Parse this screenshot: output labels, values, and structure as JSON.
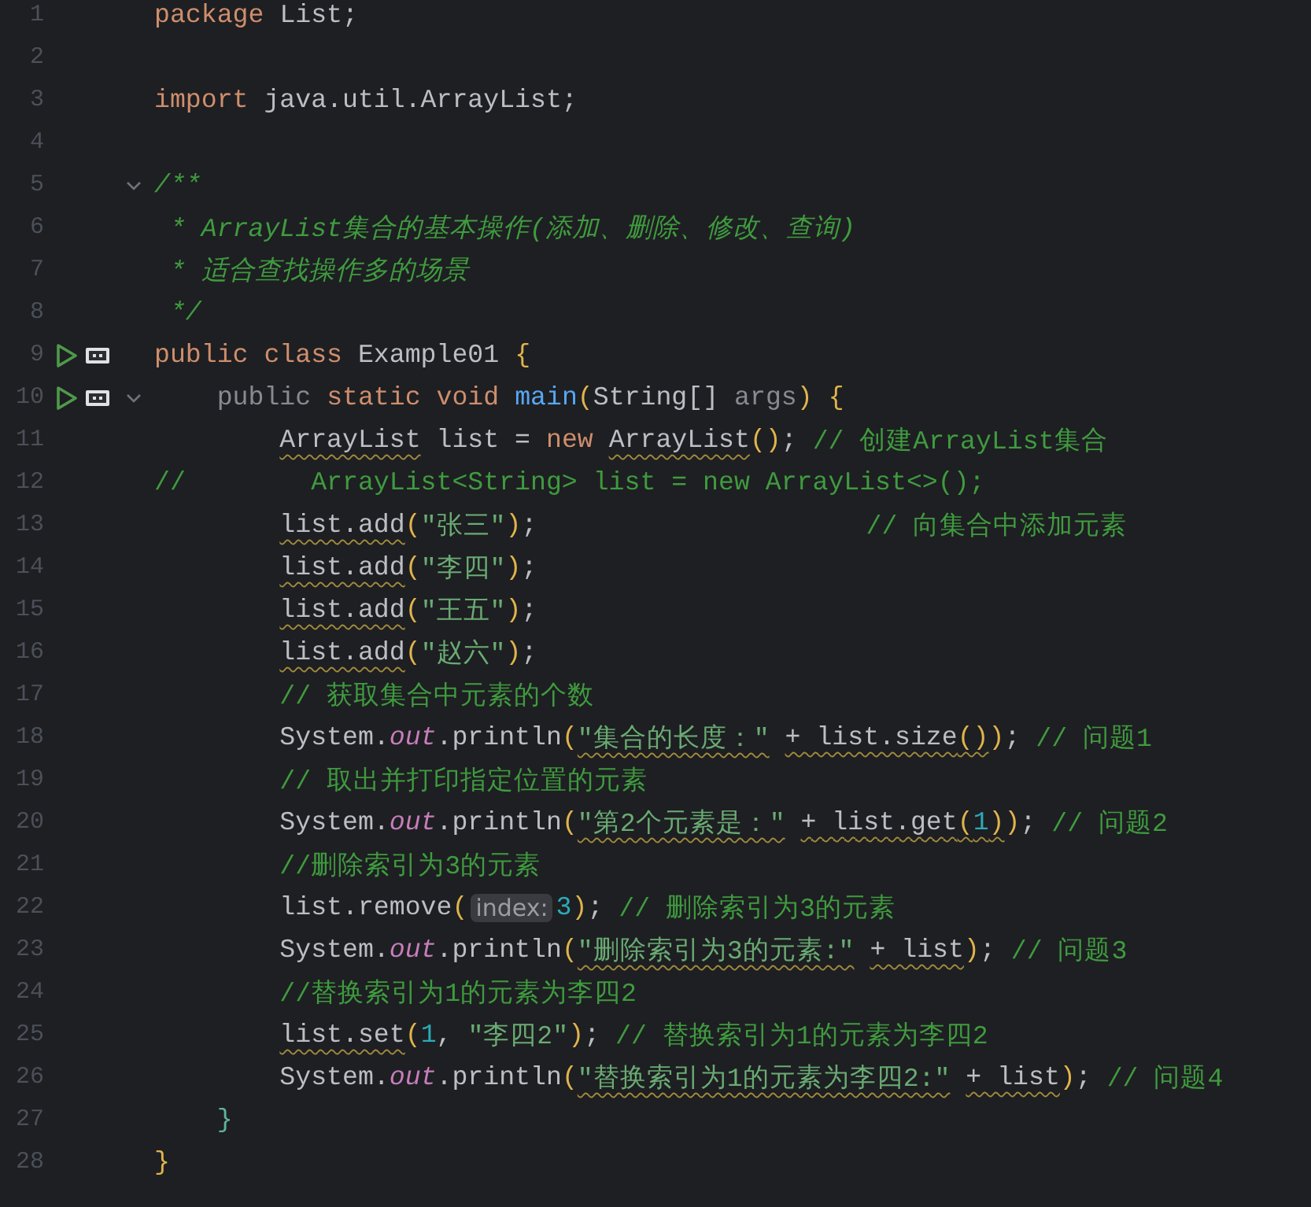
{
  "editor": {
    "lines": [
      {
        "number": "1",
        "run": false,
        "fold": false,
        "tokens": [
          {
            "kind": "keyword",
            "text": "package",
            "warning": false
          },
          {
            "kind": "plain",
            "text": " List;",
            "warning": false
          }
        ]
      },
      {
        "number": "2",
        "run": false,
        "fold": false
      },
      {
        "number": "3",
        "run": false,
        "fold": false,
        "tokens": [
          {
            "kind": "keyword",
            "text": "import",
            "warning": false
          },
          {
            "kind": "plain",
            "text": " java.util.ArrayList;",
            "warning": false
          }
        ]
      },
      {
        "number": "4",
        "run": false,
        "fold": false
      },
      {
        "number": "5",
        "run": false,
        "fold": true,
        "tokens": [
          {
            "kind": "doc",
            "text": "/**",
            "warning": false
          }
        ]
      },
      {
        "number": "6",
        "run": false,
        "fold": false,
        "tokens": [
          {
            "kind": "doc",
            "text": " * ArrayList集合的基本操作(添加、删除、修改、查询)",
            "warning": false
          }
        ]
      },
      {
        "number": "7",
        "run": false,
        "fold": false,
        "tokens": [
          {
            "kind": "doc",
            "text": " * 适合查找操作多的场景",
            "warning": false
          }
        ]
      },
      {
        "number": "8",
        "run": false,
        "fold": false,
        "tokens": [
          {
            "kind": "doc",
            "text": " */",
            "warning": false
          }
        ]
      },
      {
        "number": "9",
        "run": true,
        "fold": false,
        "tokens": [
          {
            "kind": "keyword",
            "text": "public class",
            "warning": false
          },
          {
            "kind": "plain",
            "text": " Example01 ",
            "warning": false
          },
          {
            "kind": "paren",
            "text": "{",
            "warning": false
          }
        ]
      },
      {
        "number": "10",
        "run": true,
        "fold": true,
        "tokens": [
          {
            "kind": "dim",
            "text": "    public",
            "warning": false
          },
          {
            "kind": "keyword",
            "text": " static void",
            "warning": false
          },
          {
            "kind": "method",
            "text": " main",
            "warning": false
          },
          {
            "kind": "paren",
            "text": "(",
            "warning": false
          },
          {
            "kind": "plain",
            "text": "String[]",
            "warning": false
          },
          {
            "kind": "dim",
            "text": " args",
            "warning": false
          },
          {
            "kind": "paren",
            "text": ")",
            "warning": false
          },
          {
            "kind": "paren",
            "text": " {",
            "warning": false
          }
        ]
      },
      {
        "number": "11",
        "run": false,
        "fold": false,
        "tokens": [
          {
            "kind": "plain",
            "text": "        ArrayList",
            "warning": true
          },
          {
            "kind": "plain",
            "text": " list = ",
            "warning": false
          },
          {
            "kind": "keyword",
            "text": "new",
            "warning": false
          },
          {
            "kind": "plain",
            "text": " ArrayList",
            "warning": true
          },
          {
            "kind": "paren",
            "text": "()",
            "warning": false
          },
          {
            "kind": "plain",
            "text": ";",
            "warning": false
          },
          {
            "kind": "comment",
            "text": " // 创建ArrayList集合",
            "warning": false
          }
        ]
      },
      {
        "number": "12",
        "run": false,
        "fold": false,
        "tokens": [
          {
            "kind": "comment",
            "text": "//        ArrayList<String> list = new ArrayList<>();",
            "warning": false
          }
        ]
      },
      {
        "number": "13",
        "run": false,
        "fold": false,
        "tokens": [
          {
            "kind": "plain",
            "text": "        list.add",
            "warning": true
          },
          {
            "kind": "paren",
            "text": "(",
            "warning": false
          },
          {
            "kind": "string",
            "text": "\"张三\"",
            "warning": false
          },
          {
            "kind": "paren",
            "text": ")",
            "warning": false
          },
          {
            "kind": "plain",
            "text": ";",
            "warning": false
          },
          {
            "kind": "comment",
            "text": "                     // 向集合中添加元素",
            "warning": false
          }
        ]
      },
      {
        "number": "14",
        "run": false,
        "fold": false,
        "tokens": [
          {
            "kind": "plain",
            "text": "        list.add",
            "warning": true
          },
          {
            "kind": "paren",
            "text": "(",
            "warning": false
          },
          {
            "kind": "string",
            "text": "\"李四\"",
            "warning": false
          },
          {
            "kind": "paren",
            "text": ")",
            "warning": false
          },
          {
            "kind": "plain",
            "text": ";",
            "warning": false
          }
        ]
      },
      {
        "number": "15",
        "run": false,
        "fold": false,
        "tokens": [
          {
            "kind": "plain",
            "text": "        list.add",
            "warning": true
          },
          {
            "kind": "paren",
            "text": "(",
            "warning": false
          },
          {
            "kind": "string",
            "text": "\"王五\"",
            "warning": false
          },
          {
            "kind": "paren",
            "text": ")",
            "warning": false
          },
          {
            "kind": "plain",
            "text": ";",
            "warning": false
          }
        ]
      },
      {
        "number": "16",
        "run": false,
        "fold": false,
        "tokens": [
          {
            "kind": "plain",
            "text": "        list.add",
            "warning": true
          },
          {
            "kind": "paren",
            "text": "(",
            "warning": false
          },
          {
            "kind": "string",
            "text": "\"赵六\"",
            "warning": false
          },
          {
            "kind": "paren",
            "text": ")",
            "warning": false
          },
          {
            "kind": "plain",
            "text": ";",
            "warning": false
          }
        ]
      },
      {
        "number": "17",
        "run": false,
        "fold": false,
        "tokens": [
          {
            "kind": "comment",
            "text": "        // 获取集合中元素的个数",
            "warning": false
          }
        ]
      },
      {
        "number": "18",
        "run": false,
        "fold": false,
        "tokens": [
          {
            "kind": "plain",
            "text": "        System.",
            "warning": false
          },
          {
            "kind": "field",
            "text": "out",
            "warning": false
          },
          {
            "kind": "plain",
            "text": ".println",
            "warning": false
          },
          {
            "kind": "paren",
            "text": "(",
            "warning": false
          },
          {
            "kind": "string",
            "text": "\"集合的长度：\"",
            "warning": true
          },
          {
            "kind": "plain",
            "text": " + list.size",
            "warning": true
          },
          {
            "kind": "paren",
            "text": "()",
            "warning": true
          },
          {
            "kind": "paren",
            "text": ")",
            "warning": false
          },
          {
            "kind": "plain",
            "text": ";",
            "warning": false
          },
          {
            "kind": "comment",
            "text": " // 问题1",
            "warning": false
          }
        ]
      },
      {
        "number": "19",
        "run": false,
        "fold": false,
        "tokens": [
          {
            "kind": "comment",
            "text": "        // 取出并打印指定位置的元素",
            "warning": false
          }
        ]
      },
      {
        "number": "20",
        "run": false,
        "fold": false,
        "tokens": [
          {
            "kind": "plain",
            "text": "        System.",
            "warning": false
          },
          {
            "kind": "field",
            "text": "out",
            "warning": false
          },
          {
            "kind": "plain",
            "text": ".println",
            "warning": false
          },
          {
            "kind": "paren",
            "text": "(",
            "warning": false
          },
          {
            "kind": "string",
            "text": "\"第2个元素是：\"",
            "warning": true
          },
          {
            "kind": "plain",
            "text": " + list.get",
            "warning": true
          },
          {
            "kind": "paren",
            "text": "(",
            "warning": true
          },
          {
            "kind": "number",
            "text": "1",
            "warning": true
          },
          {
            "kind": "paren",
            "text": ")",
            "warning": true
          },
          {
            "kind": "paren",
            "text": ")",
            "warning": false
          },
          {
            "kind": "plain",
            "text": ";",
            "warning": false
          },
          {
            "kind": "comment",
            "text": " // 问题2",
            "warning": false
          }
        ]
      },
      {
        "number": "21",
        "run": false,
        "fold": false,
        "tokens": [
          {
            "kind": "comment",
            "text": "        //删除索引为3的元素",
            "warning": false
          }
        ]
      },
      {
        "number": "22",
        "run": false,
        "fold": false,
        "tokens": [
          {
            "kind": "plain",
            "text": "        list.remove",
            "warning": false
          },
          {
            "kind": "paren",
            "text": "(",
            "warning": false
          },
          {
            "kind": "hint",
            "text": "index:"
          },
          {
            "kind": "number",
            "text": "3",
            "warning": false
          },
          {
            "kind": "paren",
            "text": ")",
            "warning": false
          },
          {
            "kind": "plain",
            "text": ";",
            "warning": false
          },
          {
            "kind": "comment",
            "text": " // 删除索引为3的元素",
            "warning": false
          }
        ]
      },
      {
        "number": "23",
        "run": false,
        "fold": false,
        "tokens": [
          {
            "kind": "plain",
            "text": "        System.",
            "warning": false
          },
          {
            "kind": "field",
            "text": "out",
            "warning": false
          },
          {
            "kind": "plain",
            "text": ".println",
            "warning": false
          },
          {
            "kind": "paren",
            "text": "(",
            "warning": false
          },
          {
            "kind": "string",
            "text": "\"删除索引为3的元素:\"",
            "warning": true
          },
          {
            "kind": "plain",
            "text": " + list",
            "warning": true
          },
          {
            "kind": "paren",
            "text": ")",
            "warning": false
          },
          {
            "kind": "plain",
            "text": ";",
            "warning": false
          },
          {
            "kind": "comment",
            "text": " // 问题3",
            "warning": false
          }
        ]
      },
      {
        "number": "24",
        "run": false,
        "fold": false,
        "tokens": [
          {
            "kind": "comment",
            "text": "        //替换索引为1的元素为李四2",
            "warning": false
          }
        ]
      },
      {
        "number": "25",
        "run": false,
        "fold": false,
        "tokens": [
          {
            "kind": "plain",
            "text": "        list.set",
            "warning": true
          },
          {
            "kind": "paren",
            "text": "(",
            "warning": false
          },
          {
            "kind": "number",
            "text": "1",
            "warning": false
          },
          {
            "kind": "plain",
            "text": ",",
            "warning": false
          },
          {
            "kind": "string",
            "text": " \"李四2\"",
            "warning": false
          },
          {
            "kind": "paren",
            "text": ")",
            "warning": false
          },
          {
            "kind": "plain",
            "text": ";",
            "warning": false
          },
          {
            "kind": "comment",
            "text": " // 替换索引为1的元素为李四2",
            "warning": false
          }
        ]
      },
      {
        "number": "26",
        "run": false,
        "fold": false,
        "tokens": [
          {
            "kind": "plain",
            "text": "        System.",
            "warning": false
          },
          {
            "kind": "field",
            "text": "out",
            "warning": false
          },
          {
            "kind": "plain",
            "text": ".println",
            "warning": false
          },
          {
            "kind": "paren",
            "text": "(",
            "warning": false
          },
          {
            "kind": "string",
            "text": "\"替换索引为1的元素为李四2:\"",
            "warning": true
          },
          {
            "kind": "plain",
            "text": " + list",
            "warning": true
          },
          {
            "kind": "paren",
            "text": ")",
            "warning": false
          },
          {
            "kind": "plain",
            "text": ";",
            "warning": false
          },
          {
            "kind": "comment",
            "text": " // 问题4",
            "warning": false
          }
        ]
      },
      {
        "number": "27",
        "run": false,
        "fold": false,
        "tokens": [
          {
            "kind": "brace",
            "text": "    }",
            "warning": false
          }
        ]
      },
      {
        "number": "28",
        "run": false,
        "fold": false,
        "tokens": [
          {
            "kind": "paren",
            "text": "}",
            "warning": false
          }
        ]
      }
    ]
  }
}
